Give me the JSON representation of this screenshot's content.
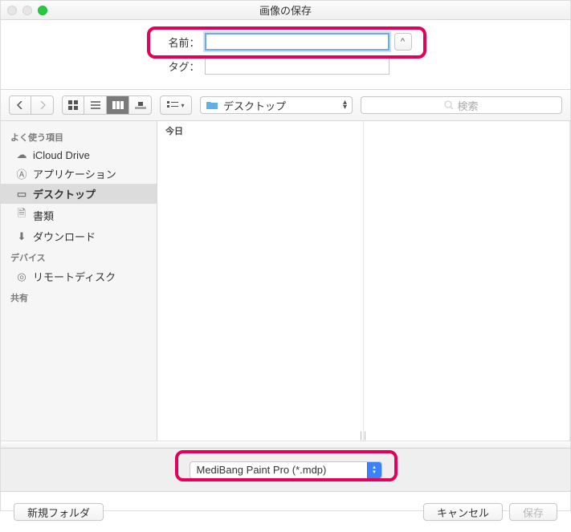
{
  "window": {
    "title": "画像の保存"
  },
  "form": {
    "name_label": "名前：",
    "name_value": "",
    "tag_label": "タグ：",
    "tag_value": "",
    "expand_glyph": "^"
  },
  "toolbar": {
    "location": {
      "icon": "folder",
      "label": "デスクトップ"
    },
    "search_placeholder": "検索"
  },
  "sidebar": {
    "sections": [
      {
        "title": "よく使う項目",
        "items": [
          {
            "icon": "cloud",
            "label": "iCloud Drive",
            "selected": false
          },
          {
            "icon": "apps",
            "label": "アプリケーション",
            "selected": false
          },
          {
            "icon": "desktop",
            "label": "デスクトップ",
            "selected": true
          },
          {
            "icon": "docs",
            "label": "書類",
            "selected": false
          },
          {
            "icon": "download",
            "label": "ダウンロード",
            "selected": false
          }
        ]
      },
      {
        "title": "デバイス",
        "items": [
          {
            "icon": "disc",
            "label": "リモートディスク",
            "selected": false
          }
        ]
      },
      {
        "title": "共有",
        "items": []
      }
    ]
  },
  "browser": {
    "header0": "今日"
  },
  "format": {
    "selected": "MediBang Paint Pro (*.mdp)"
  },
  "actions": {
    "new_folder": "新規フォルダ",
    "cancel": "キャンセル",
    "save": "保存"
  }
}
